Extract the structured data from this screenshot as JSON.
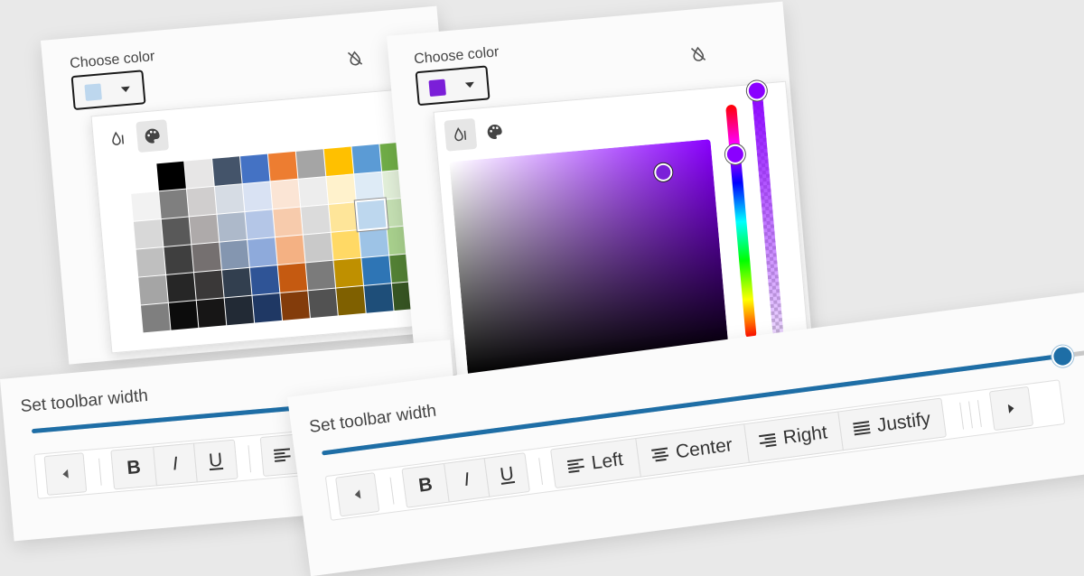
{
  "back_card": {
    "picker_label": "Choose color",
    "selected_color": "#bdd7ee",
    "active_view": "palette",
    "palette": [
      [
        "#ffffff",
        "#000000",
        "#e7e6e6",
        "#44546a",
        "#4472c4",
        "#ed7d31",
        "#a5a5a5",
        "#ffc000",
        "#5b9bd5",
        "#70ad47"
      ],
      [
        "#f2f2f2",
        "#7f7f7f",
        "#d0cece",
        "#d6dce4",
        "#d9e2f3",
        "#fbe5d5",
        "#ededed",
        "#fff2cc",
        "#deebf6",
        "#e2efd9"
      ],
      [
        "#d8d8d8",
        "#595959",
        "#aeaaaa",
        "#adb9ca",
        "#b4c6e7",
        "#f7cbac",
        "#dbdbdb",
        "#fee599",
        "#bdd7ee",
        "#c5e0b3"
      ],
      [
        "#bfbfbf",
        "#3f3f3f",
        "#757070",
        "#8496b0",
        "#8eaadb",
        "#f4b183",
        "#c9c9c9",
        "#ffd965",
        "#9dc3e6",
        "#a8d08d"
      ],
      [
        "#a5a5a5",
        "#262626",
        "#3a3838",
        "#323f4f",
        "#2f5496",
        "#c55a11",
        "#7b7b7b",
        "#bf9000",
        "#2e75b5",
        "#538135"
      ],
      [
        "#7f7f7f",
        "#0c0c0c",
        "#171616",
        "#222a35",
        "#1f3864",
        "#833c0b",
        "#525252",
        "#7f6000",
        "#1e4e79",
        "#375623"
      ]
    ],
    "toolbar_label": "Set toolbar width",
    "slider_fraction": 0.97,
    "buttons": {
      "bold": "B",
      "italic": "I",
      "underline": "U"
    }
  },
  "front_card": {
    "picker_label": "Choose color",
    "selected_color": "#7b1fd8",
    "active_view": "gradient",
    "gradient_hue_color": "#8a00ff",
    "hue_fraction": 0.18,
    "alpha_fraction": 0.0,
    "toolbar_label": "Set toolbar width",
    "slider_fraction": 0.96,
    "buttons": {
      "bold": "B",
      "italic": "I",
      "underline": "U",
      "left": "Left",
      "center": "Center",
      "right": "Right",
      "justify": "Justify"
    }
  },
  "colors": {
    "accent": "#1e6ea6",
    "track": "#c8c8c8",
    "focus_border": "#1a1a1a"
  }
}
